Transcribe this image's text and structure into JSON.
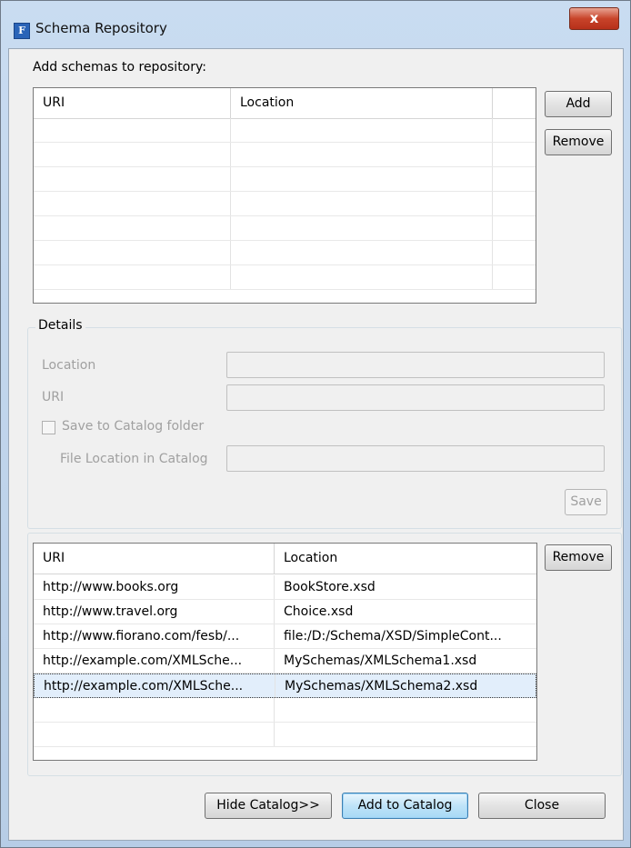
{
  "window": {
    "title": "Schema Repository",
    "app_icon_letter": "F",
    "close_symbol": "x"
  },
  "top_section": {
    "label": "Add schemas to repository:",
    "columns": [
      "URI",
      "Location",
      ""
    ],
    "rows": [],
    "add_label": "Add",
    "remove_label": "Remove"
  },
  "details": {
    "title": "Details",
    "location_label": "Location",
    "location_value": "",
    "uri_label": "URI",
    "uri_value": "",
    "save_to_catalog_label": "Save to Catalog folder",
    "save_to_catalog_checked": false,
    "file_location_label": "File Location in Catalog",
    "file_location_value": "",
    "save_label": "Save"
  },
  "catalog": {
    "columns": [
      "URI",
      "Location"
    ],
    "rows": [
      {
        "uri": "http://www.books.org",
        "location": "BookStore.xsd"
      },
      {
        "uri": "http://www.travel.org",
        "location": "Choice.xsd"
      },
      {
        "uri": "http://www.fiorano.com/fesb/...",
        "location": "file:/D:/Schema/XSD/SimpleCont..."
      },
      {
        "uri": "http://example.com/XMLSche...",
        "location": "MySchemas/XMLSchema1.xsd"
      },
      {
        "uri": "http://example.com/XMLSche...",
        "location": "MySchemas/XMLSchema2.xsd",
        "selected": true
      }
    ],
    "remove_label": "Remove"
  },
  "footer": {
    "hide_catalog_label": "Hide Catalog>>",
    "add_to_catalog_label": "Add to Catalog",
    "close_label": "Close"
  },
  "colors": {
    "title_bar": "#c9dcf1",
    "close_button": "#c8442a",
    "selection": "#e2eefb",
    "default_button": "#bfe3f8"
  }
}
